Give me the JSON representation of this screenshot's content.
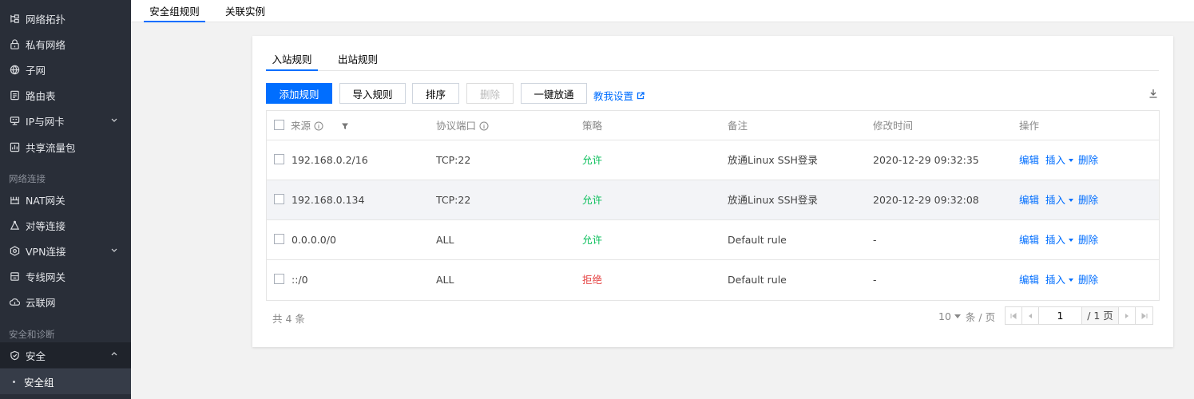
{
  "sidebar": {
    "items": [
      {
        "label": "网络拓扑",
        "icon": "topology-icon"
      },
      {
        "label": "私有网络",
        "icon": "vpc-icon"
      },
      {
        "label": "子网",
        "icon": "subnet-icon"
      },
      {
        "label": "路由表",
        "icon": "route-table-icon"
      },
      {
        "label": "IP与网卡",
        "icon": "ip-nic-icon"
      },
      {
        "label": "共享流量包",
        "icon": "traffic-package-icon"
      },
      {
        "label": "NAT网关",
        "icon": "nat-gateway-icon"
      },
      {
        "label": "对等连接",
        "icon": "peering-icon"
      },
      {
        "label": "VPN连接",
        "icon": "vpn-icon"
      },
      {
        "label": "专线网关",
        "icon": "dc-gateway-icon"
      },
      {
        "label": "云联网",
        "icon": "ccn-icon"
      },
      {
        "label": "安全",
        "icon": "shield-icon"
      }
    ],
    "groups": [
      "网络连接",
      "安全和诊断"
    ],
    "sub_item": "安全组"
  },
  "top_tabs": [
    "安全组规则",
    "关联实例"
  ],
  "sub_tabs": [
    "入站规则",
    "出站规则"
  ],
  "toolbar": {
    "add": "添加规则",
    "import": "导入规则",
    "sort": "排序",
    "delete": "删除",
    "open_all": "一键放通",
    "help": "教我设置"
  },
  "table": {
    "headers": [
      "来源",
      "协议端口",
      "策略",
      "备注",
      "修改时间",
      "操作"
    ],
    "rows": [
      {
        "source": "192.168.0.2/16",
        "port": "TCP:22",
        "policy": "允许",
        "note": "放通Linux SSH登录",
        "time": "2020-12-29 09:32:35"
      },
      {
        "source": "192.168.0.134",
        "port": "TCP:22",
        "policy": "允许",
        "note": "放通Linux SSH登录",
        "time": "2020-12-29 09:32:08"
      },
      {
        "source": "0.0.0.0/0",
        "port": "ALL",
        "policy": "允许",
        "note": "Default rule",
        "time": "-"
      },
      {
        "source": "::/0",
        "port": "ALL",
        "policy": "拒绝",
        "note": "Default rule",
        "time": "-"
      }
    ],
    "ops": {
      "edit": "编辑",
      "insert": "插入",
      "delete": "删除"
    }
  },
  "pager": {
    "total": "共 4 条",
    "page_size": "10",
    "page_size_unit": "条 / 页",
    "current_page": "1",
    "total_pages": "/ 1 页"
  },
  "colors": {
    "accent": "#006eff",
    "allow": "#0abf5b",
    "deny": "#e54545",
    "sidebar_bg": "#292e38"
  }
}
